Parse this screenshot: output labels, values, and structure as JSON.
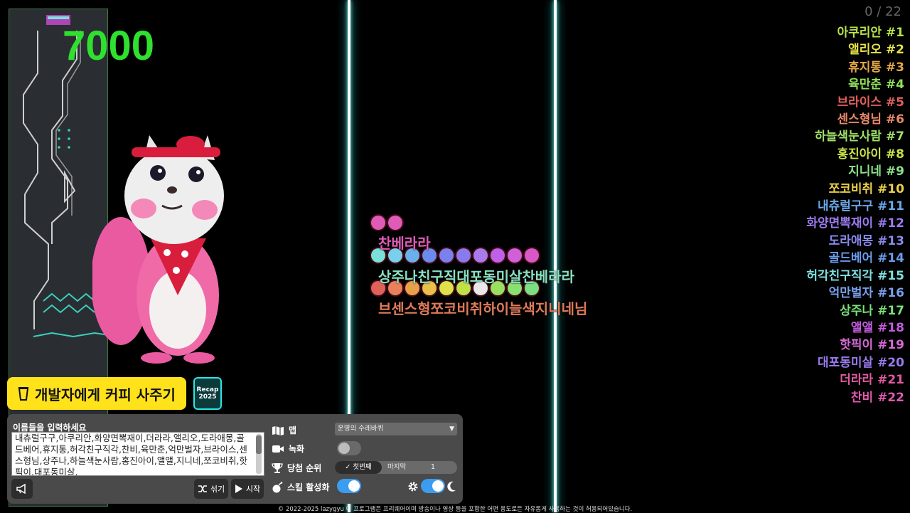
{
  "hud": {
    "score": "7000",
    "counter": "0 / 22"
  },
  "ranking": [
    {
      "label": "아쿠리안 #1",
      "color": "#b7e34a"
    },
    {
      "label": "앨리오 #2",
      "color": "#e6e24a"
    },
    {
      "label": "휴지통 #3",
      "color": "#e8a84a"
    },
    {
      "label": "육만춘 #4",
      "color": "#8fe05a"
    },
    {
      "label": "브라이스 #5",
      "color": "#e0605a"
    },
    {
      "label": "센스형님 #6",
      "color": "#e8896a"
    },
    {
      "label": "하늘색눈사람 #7",
      "color": "#9fe06a"
    },
    {
      "label": "홍진아이 #8",
      "color": "#c9e24a"
    },
    {
      "label": "지니네 #9",
      "color": "#8de28a"
    },
    {
      "label": "쪼코비취 #10",
      "color": "#e8d04a"
    },
    {
      "label": "내츄럴구구 #11",
      "color": "#6aa8ec"
    },
    {
      "label": "화양면뽁재이 #12",
      "color": "#9a7aec"
    },
    {
      "label": "도라애몽 #13",
      "color": "#8a8aec"
    },
    {
      "label": "골드베어 #14",
      "color": "#6a9cec"
    },
    {
      "label": "허각친구직각 #15",
      "color": "#7fe0e0"
    },
    {
      "label": "억만벌자 #16",
      "color": "#7aa0ec"
    },
    {
      "label": "상주나 #17",
      "color": "#7ae07a"
    },
    {
      "label": "앨앨 #18",
      "color": "#c45ce0"
    },
    {
      "label": "핫픽이 #19",
      "color": "#d86ad8"
    },
    {
      "label": "대포동미살 #20",
      "color": "#9a7aec"
    },
    {
      "label": "더라라 #21",
      "color": "#e05aa0"
    },
    {
      "label": "찬비 #22",
      "color": "#e05ab0"
    }
  ],
  "marbles": {
    "row1_colors": [
      "#e05ab8",
      "#e05ab8"
    ],
    "row1_label": "찬베라라",
    "row2_colors": [
      "#7ae0d8",
      "#7ad0ec",
      "#6ab0ec",
      "#6a8cec",
      "#7a80ec",
      "#8a7aec",
      "#a87aec",
      "#c060e8",
      "#d060d8",
      "#d858c8"
    ],
    "row2_label": "상주나친구직대포동미살찬베라라",
    "row3_colors": [
      "#e0605a",
      "#e8805a",
      "#e8a04a",
      "#e8c04a",
      "#e0e04a",
      "#c0e04a",
      "#e8e8e8",
      "#9ae060",
      "#8ae070",
      "#7ae080"
    ],
    "row3_label": "브센스형쪼코비취하이늘색지니네님"
  },
  "buttons": {
    "coffee_label": "개발자에게 커피 사주기",
    "recap_line1": "Recap",
    "recap_line2": "2025"
  },
  "panel": {
    "names_label": "이름들을 입력하세요",
    "names_value": "내츄럴구구,아쿠리안,화양면뽁재이,더라라,앨리오,도라애몽,골드베어,휴지통,허각친구직각,찬비,육만춘,억만벌자,브라이스,센스형님,상주나,하늘색눈사람,홍진아이,앨앨,지니네,쪼코비취,핫픽이,대포동미살,",
    "map_label": "맵",
    "map_value": "운명의 수레바퀴",
    "record_label": "녹화",
    "record_on": false,
    "rank_label": "당첨 순위",
    "rank_first": "✓ 첫번째",
    "rank_last": "마지막",
    "rank_number": "1",
    "skill_label": "스킬 활성화",
    "skill_on": true,
    "shuffle_label": "섞기",
    "start_label": "시작",
    "accent_color": "#3b9cf0"
  },
  "footer": "© 2022-2025 lazygyu 이 프로그램은 프리웨어이며 방송이나 영상 등을 포함한 어떤 용도로든 자유롭게 사용하는 것이 허용되어있습니다."
}
